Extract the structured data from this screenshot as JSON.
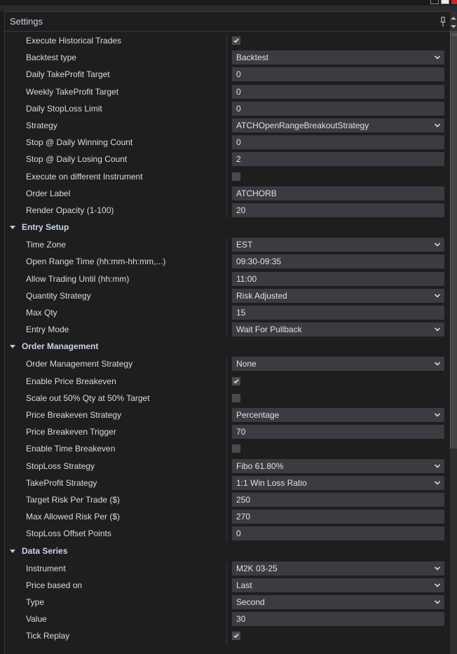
{
  "window": {
    "controls": [
      "minimize-button",
      "restore-button",
      "close-button"
    ]
  },
  "panel": {
    "title": "Settings",
    "pin_icon": "pin-icon"
  },
  "general": [
    {
      "label": "Execute Historical Trades",
      "type": "checkbox",
      "checked": true
    },
    {
      "label": "Backtest type",
      "type": "select",
      "value": "Backtest"
    },
    {
      "label": "Daily TakeProfit Target",
      "type": "text",
      "value": "0"
    },
    {
      "label": "Weekly TakeProfit Target",
      "type": "text",
      "value": "0"
    },
    {
      "label": "Daily StopLoss Limit",
      "type": "text",
      "value": "0"
    },
    {
      "label": "Strategy",
      "type": "select",
      "value": "ATCHOpenRangeBreakoutStrategy"
    },
    {
      "label": "Stop @ Daily Winning Count",
      "type": "text",
      "value": "0"
    },
    {
      "label": "Stop @ Daily Losing Count",
      "type": "text",
      "value": "2"
    },
    {
      "label": "Execute on different Instrument",
      "type": "checkbox",
      "checked": false
    },
    {
      "label": "Order Label",
      "type": "text",
      "value": "ATCHORB"
    },
    {
      "label": "Render Opacity (1-100)",
      "type": "text",
      "value": "20"
    }
  ],
  "sections": [
    {
      "title": "Entry Setup",
      "expanded": true,
      "rows": [
        {
          "label": "Time Zone",
          "type": "select",
          "value": "EST"
        },
        {
          "label": "Open Range Time (hh:mm-hh:mm,...)",
          "type": "text",
          "value": "09:30-09:35"
        },
        {
          "label": "Allow Trading Until (hh:mm)",
          "type": "text",
          "value": "11:00"
        },
        {
          "label": "Quantity Strategy",
          "type": "select",
          "value": "Risk Adjusted"
        },
        {
          "label": "Max Qty",
          "type": "text",
          "value": "15"
        },
        {
          "label": "Entry Mode",
          "type": "select",
          "value": "Wait For Pullback"
        }
      ]
    },
    {
      "title": "Order Management",
      "expanded": true,
      "rows": [
        {
          "label": "Order Management Strategy",
          "type": "select",
          "value": "None"
        },
        {
          "label": "Enable Price Breakeven",
          "type": "checkbox",
          "checked": true
        },
        {
          "label": "Scale out 50% Qty at 50% Target",
          "type": "checkbox",
          "checked": false
        },
        {
          "label": "Price Breakeven Strategy",
          "type": "select",
          "value": "Percentage"
        },
        {
          "label": "Price Breakeven Trigger",
          "type": "text",
          "value": "70"
        },
        {
          "label": "Enable Time Breakeven",
          "type": "checkbox",
          "checked": false
        },
        {
          "label": "StopLoss Strategy",
          "type": "select",
          "value": "Fibo 61.80%"
        },
        {
          "label": "TakeProfit Strategy",
          "type": "select",
          "value": "1:1 Win Loss Ratio"
        },
        {
          "label": "Target Risk Per Trade ($)",
          "type": "text",
          "value": "250"
        },
        {
          "label": "Max Allowed Risk Per ($)",
          "type": "text",
          "value": "270"
        },
        {
          "label": "StopLoss Offset Points",
          "type": "text",
          "value": "0"
        }
      ]
    },
    {
      "title": "Data Series",
      "expanded": true,
      "rows": [
        {
          "label": "Instrument",
          "type": "select",
          "value": "M2K 03-25"
        },
        {
          "label": "Price based on",
          "type": "select",
          "value": "Last"
        },
        {
          "label": "Type",
          "type": "select",
          "value": "Second"
        },
        {
          "label": "Value",
          "type": "text",
          "value": "30"
        },
        {
          "label": "Tick Replay",
          "type": "checkbox",
          "checked": true
        }
      ]
    }
  ],
  "colors": {
    "background": "#1e1e1f",
    "field": "#3c3b42",
    "header_text": "#c9d3e8",
    "close_button": "#c4262b"
  }
}
